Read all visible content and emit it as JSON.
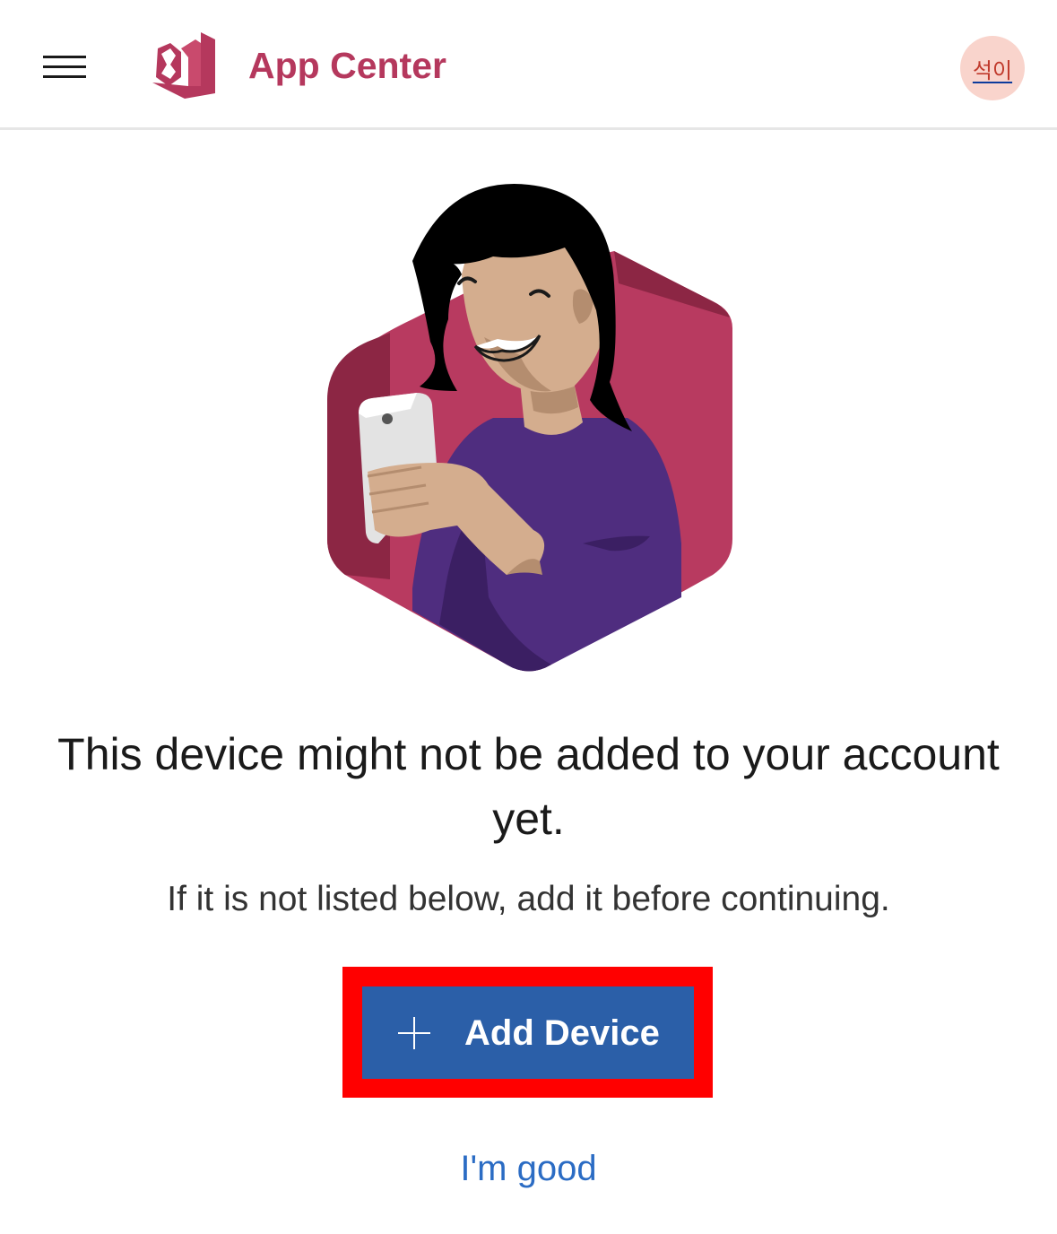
{
  "header": {
    "app_title": "App Center",
    "menu_icon": "hamburger-menu-icon",
    "logo_icon": "app-center-logo-icon",
    "avatar_initials": "석이",
    "brand_color": "#b5385d",
    "avatar_bg_color": "#f9d4cc"
  },
  "illustration": {
    "icon": "person-holding-phone-illustration"
  },
  "main": {
    "headline": "This device might not be added to your account yet.",
    "subline": "If it is not listed below, add it before continuing.",
    "add_device_label": "Add Device",
    "add_device_icon": "plus-icon",
    "button_color": "#2b5fa8",
    "highlight_color": "#ff0000",
    "im_good_label": "I'm good",
    "link_color": "#2b6cc4"
  }
}
